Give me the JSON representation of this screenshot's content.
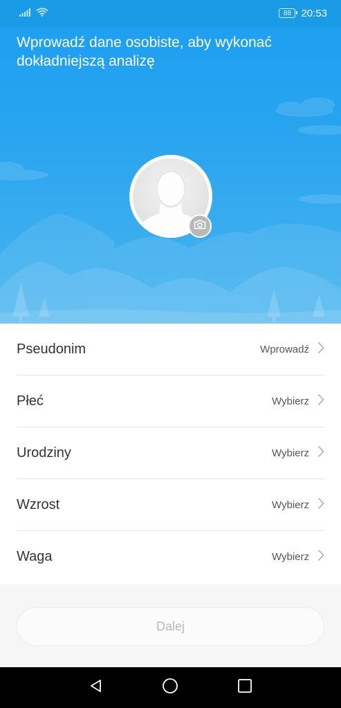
{
  "status_bar": {
    "battery": "88",
    "time": "20:53",
    "icons": [
      "signal-icon",
      "wifi-icon",
      "battery-icon"
    ]
  },
  "hero": {
    "title": "Wprowadź dane osobiste, aby wykonać dokładniejszą analizę"
  },
  "form": {
    "rows": [
      {
        "label": "Pseudonim",
        "value": "Wprowadź"
      },
      {
        "label": "Płeć",
        "value": "Wybierz"
      },
      {
        "label": "Urodziny",
        "value": "Wybierz"
      },
      {
        "label": "Wzrost",
        "value": "Wybierz"
      },
      {
        "label": "Waga",
        "value": "Wybierz"
      }
    ]
  },
  "next_button": "Dalej",
  "nav": {
    "icons": [
      "back-icon",
      "home-icon",
      "recents-icon"
    ]
  },
  "colors": {
    "accent": "#1a9be6",
    "hero_light": "#45b3ef",
    "disabled_text": "#b9b9b9"
  }
}
